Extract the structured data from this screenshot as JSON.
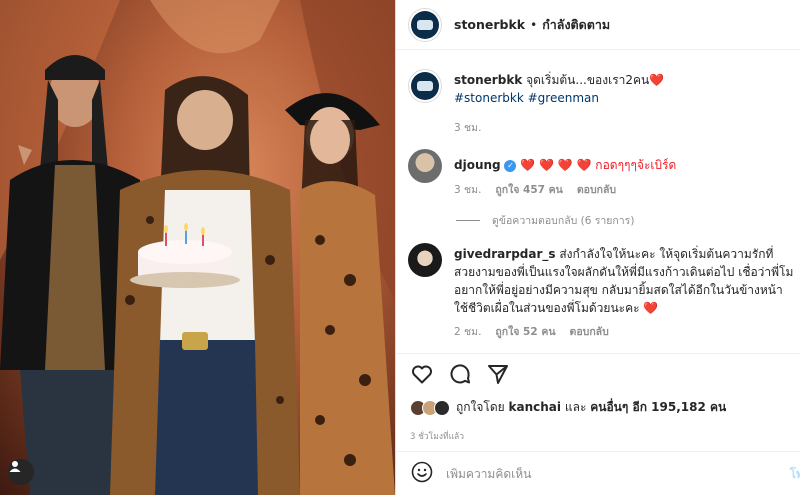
{
  "header": {
    "username": "stonerbkk",
    "separator": "•",
    "follow_status": "กำลังติดตาม"
  },
  "caption": {
    "username": "stonerbkk",
    "text": "จุดเริ่มต้น...ของเรา2คน",
    "emoji": "❤️",
    "hashtags": "#stonerbkk #greenman",
    "time": "3 ชม."
  },
  "comments": [
    {
      "username": "djoung",
      "verified": true,
      "text": "❤️ ❤️ ❤️ ❤️ กอดๆๆๆจ้ะเบิร์ด",
      "time": "3 ชม.",
      "likes": "ถูกใจ 457 คน",
      "reply_label": "ตอบกลับ",
      "view_replies": "ดูข้อความตอบกลับ (6 รายการ)"
    },
    {
      "username": "givedrarpdar_s",
      "text": "ส่งกำลังใจให้นะคะ ให้จุดเริ่มต้นความรักที่สวยงามของพี่เป็นแรงใจผลักดันให้พี่มีแรงก้าวเดินต่อไป เชื่อว่าพี่โมอยากให้พี่อยู่อย่างมีความสุข กลับมายิ้มสดใสได้อีกในวันข้างหน้า ใช้ชีวิตเผื่อในส่วนของพี่โมด้วยนะคะ ❤️",
      "time": "2 ชม.",
      "likes": "ถูกใจ 52 คน",
      "reply_label": "ตอบกลับ"
    }
  ],
  "likes": {
    "prefix": "ถูกใจโดย",
    "user": "kanchai",
    "middle": "และ",
    "others": "คนอื่นๆ อีก 195,182 คน"
  },
  "time_ago": "3 ชั่วโมงที่แล้ว",
  "add_comment": {
    "placeholder": "เพิ่มความคิดเห็น",
    "post_label": "โพ"
  },
  "icons": {
    "like": "heart-icon",
    "comment": "comment-icon",
    "share": "share-icon",
    "emoji": "emoji-icon",
    "user_tag": "user-tag-icon"
  },
  "colors": {
    "link": "#00376b",
    "heart": "#ed1c24",
    "verified": "#3897f0",
    "muted": "#8e8e8e",
    "post_disabled": "#b2dffc"
  }
}
